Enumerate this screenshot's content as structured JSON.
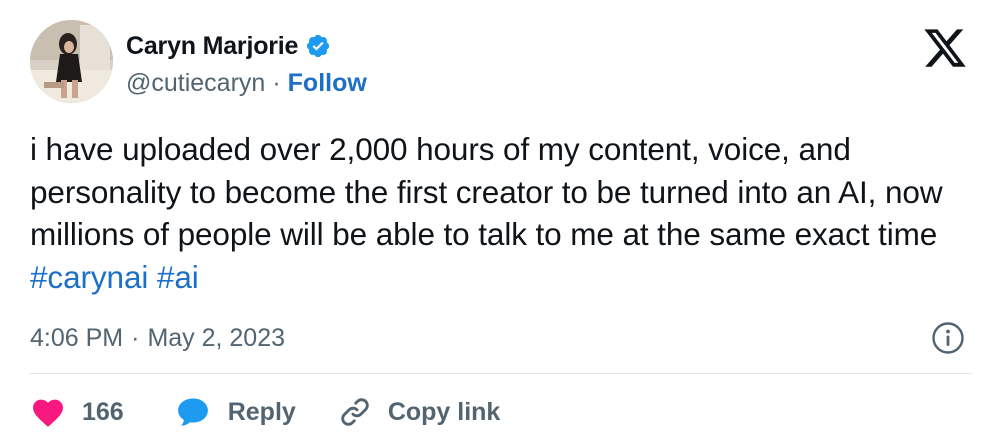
{
  "author": {
    "name": "Caryn Marjorie",
    "handle": "@cutiecaryn",
    "separator": "·",
    "follow_label": "Follow"
  },
  "tweet": {
    "text": "i have uploaded over 2,000 hours of my content, voice, and personality to become the first creator to be turned into an AI, now millions of people will be able to talk to me at the same exact time",
    "hashtags": [
      "#carynai",
      "#ai"
    ]
  },
  "meta": {
    "time": "4:06 PM",
    "separator": "·",
    "date": "May 2, 2023"
  },
  "actions": {
    "like_count": "166",
    "reply_label": "Reply",
    "copy_label": "Copy link"
  },
  "colors": {
    "accent": "#1d6fc7",
    "like": "#f91880",
    "reply_icon": "#1d9bf0",
    "secondary_text": "#536471"
  },
  "icons": [
    "verified-badge-icon",
    "x-logo-icon",
    "info-icon",
    "heart-icon",
    "reply-bubble-icon",
    "link-icon"
  ]
}
